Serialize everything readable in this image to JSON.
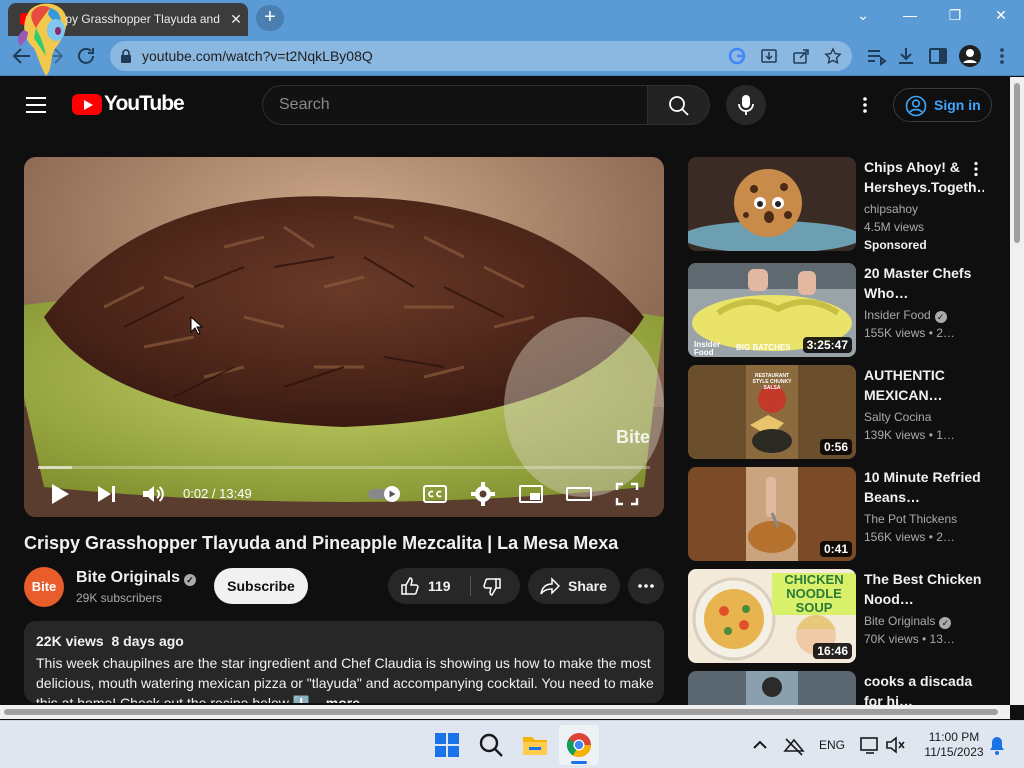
{
  "browser": {
    "tab_title": "Crispy Grasshopper Tlayuda and",
    "tab_close": "✕",
    "new_tab": "+",
    "url": "youtube.com/watch?v=t2NqkLBy08Q",
    "window_controls": [
      "⌄",
      "—",
      "❐",
      "✕"
    ]
  },
  "youtube": {
    "logo_text": "YouTube",
    "search_placeholder": "Search",
    "sign_in": "Sign in"
  },
  "player": {
    "watermark": "Bite",
    "time": "0:02 / 13:49",
    "progress_fraction": 0.055
  },
  "video": {
    "title": "Crispy Grasshopper Tlayuda and Pineapple Mezcalita | La Mesa Mexa",
    "channel_avatar_text": "Bite",
    "channel_name": "Bite Originals",
    "subscribers": "29K subscribers",
    "subscribe_label": "Subscribe",
    "likes": "119",
    "share_label": "Share"
  },
  "description": {
    "meta": "22K views  8 days ago",
    "text": "This week chaupilnes are the star ingredient and Chef Claudia is showing us how to make the most delicious, mouth watering mexican pizza or \"tlayuda\" and accompanying cocktail. You need to make this at home! Check out the recipe below ⬇️",
    "more": "...more"
  },
  "recommendations": [
    {
      "title": "Chips Ahoy! & Hersheys.Togeth…",
      "channel": "chipsahoy",
      "views": "4.5M views",
      "sponsored": "Sponsored",
      "duration": "",
      "verified": false
    },
    {
      "title": "20 Master Chefs Who…",
      "channel": "Insider Food",
      "views": "155K views  • 2…",
      "duration": "3:25:47",
      "verified": true
    },
    {
      "title": "AUTHENTIC MEXICAN…",
      "channel": "Salty Cocina",
      "views": "139K views  • 1…",
      "duration": "0:56",
      "verified": false
    },
    {
      "title": "10 Minute Refried Beans…",
      "channel": "The Pot Thickens",
      "views": "156K views  • 2…",
      "duration": "0:41",
      "verified": false
    },
    {
      "title": "The Best Chicken Nood…",
      "channel": "Bite Originals",
      "views": "70K views  • 13…",
      "duration": "16:46",
      "verified": true
    },
    {
      "title": "cooks a discada for hi…",
      "channel": "",
      "views": "",
      "duration": "",
      "verified": false
    }
  ],
  "thumb_text": {
    "insider_food": "Insider Food",
    "big_batches": "BIG BATCHES",
    "salsa": "RESTAURANT STYLE CHUNKY SALSA",
    "chicken_soup": "CHICKEN NOODLE SOUP"
  },
  "taskbar": {
    "lang": "ENG",
    "time": "11:00 PM",
    "date": "11/15/2023"
  },
  "colors": {
    "youtube_red": "#ff0000",
    "link_blue": "#3ea6ff",
    "chrome_blue": "#5b9bd5"
  }
}
